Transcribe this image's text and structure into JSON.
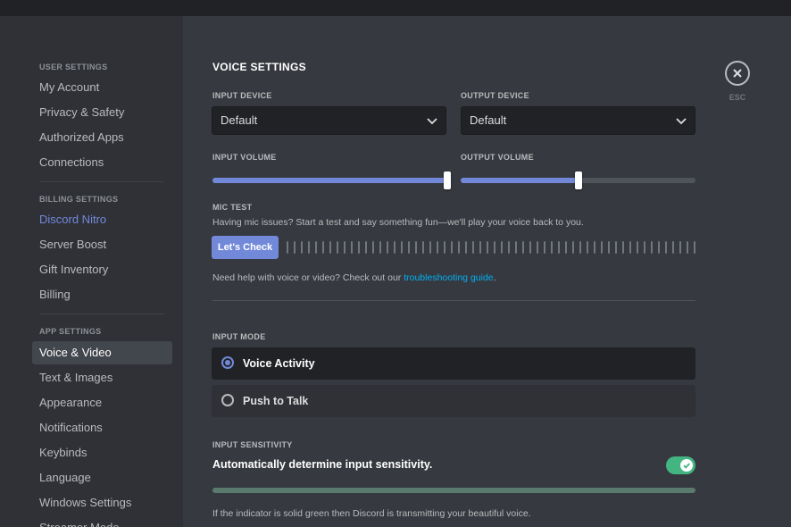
{
  "sidebar": {
    "user_settings_header": "USER SETTINGS",
    "user_items": [
      "My Account",
      "Privacy & Safety",
      "Authorized Apps",
      "Connections"
    ],
    "billing_settings_header": "BILLING SETTINGS",
    "billing_items": [
      "Discord Nitro",
      "Server Boost",
      "Gift Inventory",
      "Billing"
    ],
    "app_settings_header": "APP SETTINGS",
    "app_items": [
      "Voice & Video",
      "Text & Images",
      "Appearance",
      "Notifications",
      "Keybinds",
      "Language",
      "Windows Settings",
      "Streamer Mode"
    ],
    "selected": "Voice & Video"
  },
  "main": {
    "title": "VOICE SETTINGS",
    "input_device_label": "INPUT DEVICE",
    "input_device_value": "Default",
    "output_device_label": "OUTPUT DEVICE",
    "output_device_value": "Default",
    "input_volume_label": "INPUT VOLUME",
    "input_volume_percent": 100,
    "output_volume_label": "OUTPUT VOLUME",
    "output_volume_percent": 50,
    "mic_test_label": "MIC TEST",
    "mic_test_desc": "Having mic issues? Start a test and say something fun—we'll play your voice back to you.",
    "lets_check_label": "Let's Check",
    "help_prefix": "Need help with voice or video? Check out our ",
    "help_link": "troubleshooting guide",
    "help_suffix": ".",
    "input_mode_label": "INPUT MODE",
    "input_mode_options": [
      "Voice Activity",
      "Push to Talk"
    ],
    "input_mode_selected": "Voice Activity",
    "input_sensitivity_label": "INPUT SENSITIVITY",
    "auto_sensitivity_label": "Automatically determine input sensitivity.",
    "auto_sensitivity_enabled": true,
    "sensitivity_note": "If the indicator is solid green then Discord is transmitting your beautiful voice."
  },
  "esc": {
    "icon": "close-icon",
    "label": "ESC"
  },
  "colors": {
    "accent": "#7289da",
    "link": "#00b0f4",
    "toggle_on": "#43b581",
    "background": "#36393f",
    "sidebar": "#2f3136"
  }
}
